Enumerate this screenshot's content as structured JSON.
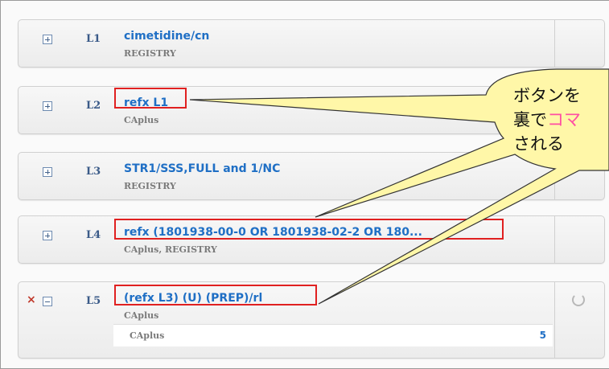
{
  "rows": [
    {
      "id": "L1",
      "query": "cimetidine/cn",
      "db": "REGISTRY"
    },
    {
      "id": "L2",
      "query": "refx L1",
      "db": "CAplus"
    },
    {
      "id": "L3",
      "query": "STR1/SSS,FULL and 1/NC",
      "db": "REGISTRY"
    },
    {
      "id": "L4",
      "query": "refx (1801938-00-0 OR 1801938-02-2 OR 180...",
      "db": "CAplus, REGISTRY"
    },
    {
      "id": "L5",
      "query": "(refx L3) (U) (PREP)/rl",
      "db": "CAplus",
      "delete_mark": "×",
      "sub_db": "CAplus",
      "sub_count": "5"
    }
  ],
  "callout": {
    "line1": "ボタンを",
    "line2_a": "裏で",
    "line2_b": "コマ",
    "line3": "される"
  },
  "colors": {
    "query": "#1f6fc5",
    "highlight": "#e02020",
    "callout_fill": "#fff7a8",
    "callout_pink": "#ff4fa3"
  }
}
